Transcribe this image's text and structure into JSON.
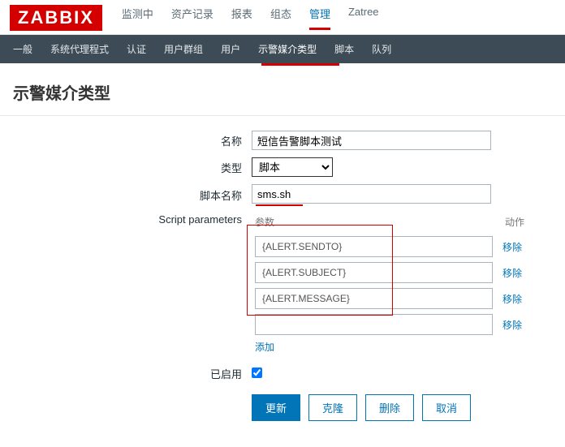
{
  "logo": "ZABBIX",
  "topNav": {
    "items": [
      "监测中",
      "资产记录",
      "报表",
      "组态",
      "管理",
      "Zatree"
    ],
    "activeIndex": 4
  },
  "subNav": {
    "items": [
      "一般",
      "系统代理程式",
      "认证",
      "用户群组",
      "用户",
      "示警媒介类型",
      "脚本",
      "队列"
    ],
    "activeIndex": 5
  },
  "pageTitle": "示警媒介类型",
  "form": {
    "nameLabel": "名称",
    "nameValue": "短信告警脚本测试",
    "typeLabel": "类型",
    "typeValue": "脚本",
    "scriptNameLabel": "脚本名称",
    "scriptNameValue": "sms.sh",
    "paramsLabel": "Script parameters",
    "paramsHeaderParam": "参数",
    "paramsHeaderAction": "动作",
    "params": [
      {
        "value": "{ALERT.SENDTO}"
      },
      {
        "value": "{ALERT.SUBJECT}"
      },
      {
        "value": "{ALERT.MESSAGE}"
      }
    ],
    "blankParam": "",
    "removeLabel": "移除",
    "addLabel": "添加",
    "enabledLabel": "已启用",
    "enabledChecked": true
  },
  "buttons": {
    "update": "更新",
    "clone": "克隆",
    "delete": "删除",
    "cancel": "取消"
  }
}
